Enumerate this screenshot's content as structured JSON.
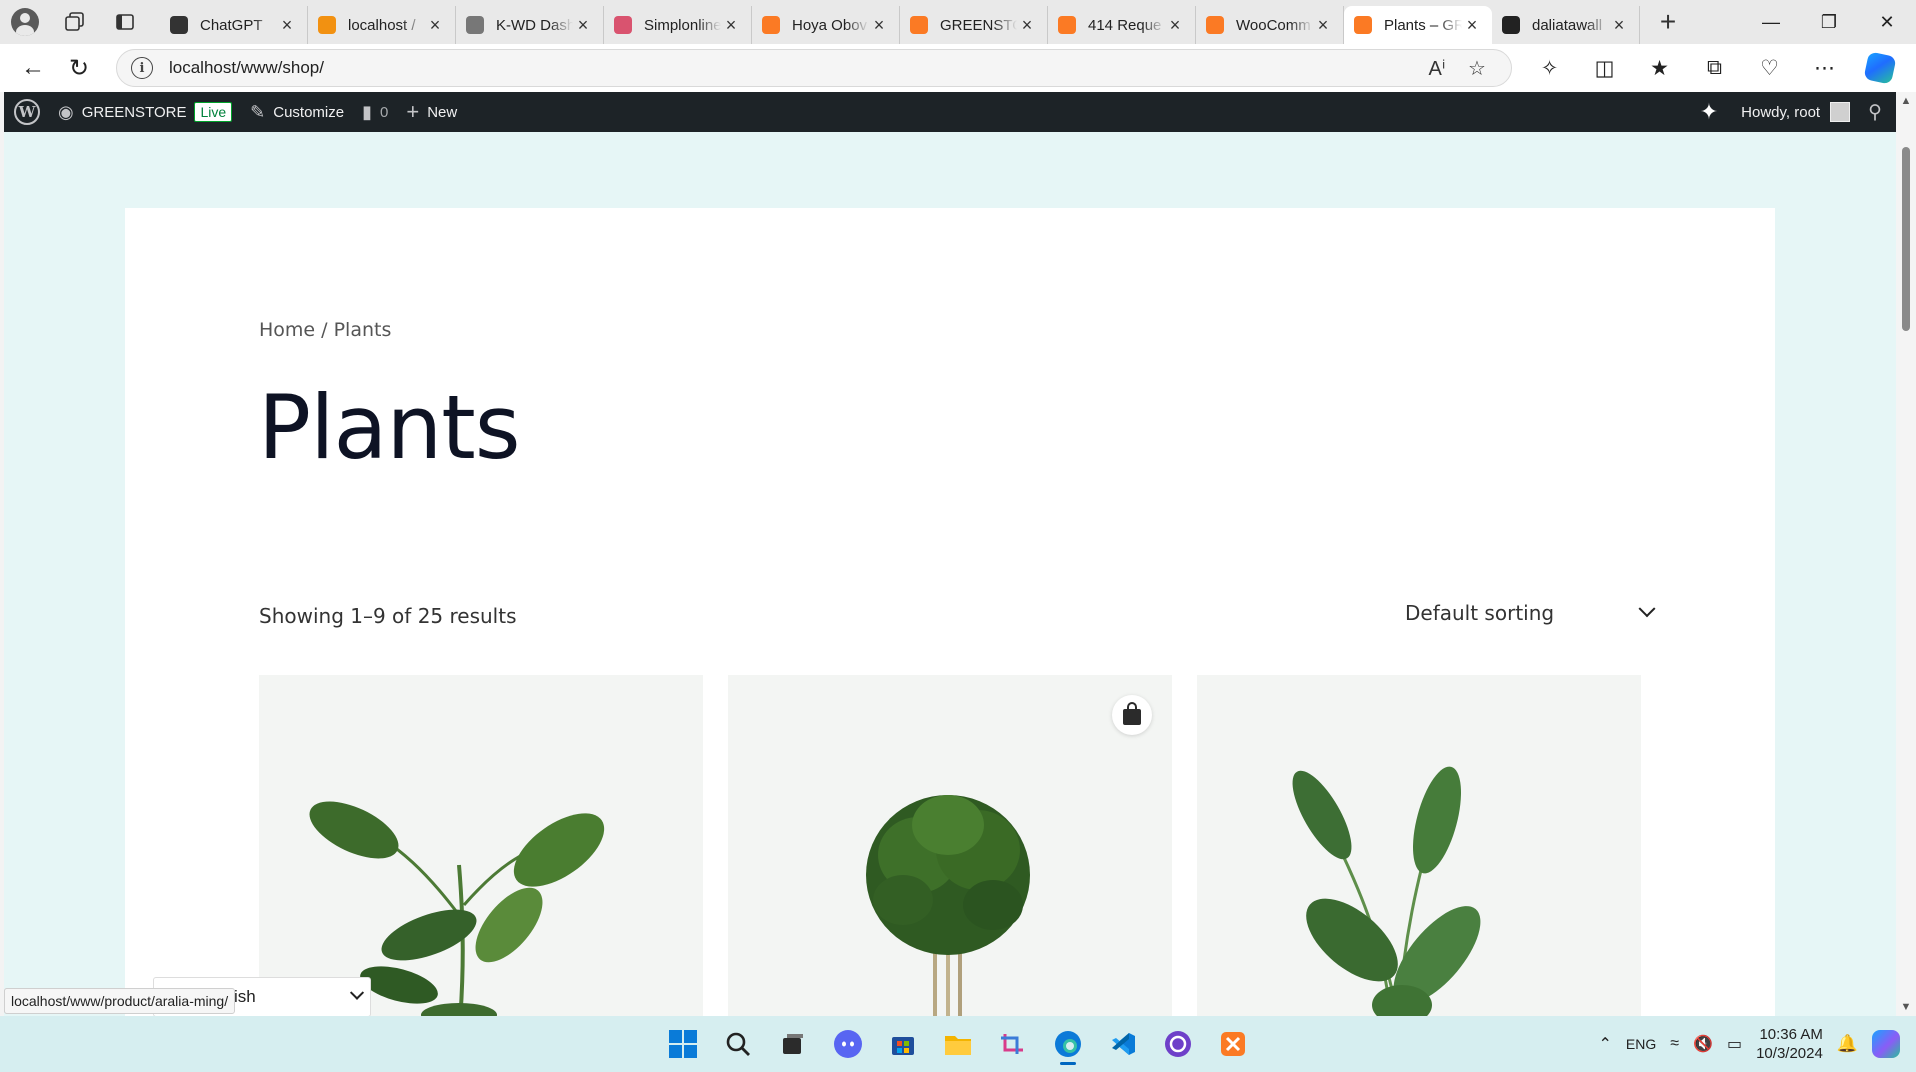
{
  "browser": {
    "tabs": [
      {
        "label": "ChatGPT",
        "icon": "chatgpt-icon",
        "color": "#333333",
        "active": false
      },
      {
        "label": "localhost / ",
        "icon": "phpmyadmin-icon",
        "color": "#f29111",
        "active": false
      },
      {
        "label": "K-WD Dash",
        "icon": "document-icon",
        "color": "#777777",
        "active": false
      },
      {
        "label": "Simplonline",
        "icon": "simplon-icon",
        "color": "#d9536f",
        "active": false
      },
      {
        "label": "Hoya Obov",
        "icon": "xampp-icon",
        "color": "#fb7a24",
        "active": false
      },
      {
        "label": "GREENSTO",
        "icon": "xampp-icon",
        "color": "#fb7a24",
        "active": false
      },
      {
        "label": "414 Reque",
        "icon": "xampp-icon",
        "color": "#fb7a24",
        "active": false
      },
      {
        "label": "WooComm",
        "icon": "xampp-icon",
        "color": "#fb7a24",
        "active": false
      },
      {
        "label": "Plants – GR",
        "icon": "xampp-icon",
        "color": "#fb7a24",
        "active": true
      },
      {
        "label": "daliatawall",
        "icon": "github-icon",
        "color": "#222222",
        "active": false
      }
    ],
    "url": "localhost/www/shop/"
  },
  "adminbar": {
    "site_name": "GREENSTORE",
    "live_badge": "Live",
    "customize": "Customize",
    "comments_count": "0",
    "new_label": "New",
    "howdy": "Howdy, root"
  },
  "page": {
    "breadcrumb": "Home / Plants",
    "title": "Plants",
    "result_count": "Showing 1–9 of 25 results",
    "sorting": "Default sorting"
  },
  "products": [
    {
      "name": "aralia-ming-image",
      "plant": "philodendron"
    },
    {
      "name": "bushy-plant-image",
      "plant": "aralia"
    },
    {
      "name": "strelitzia-image",
      "plant": "strelitzia"
    }
  ],
  "language_switcher": {
    "label": "English"
  },
  "status_bar": {
    "url": "localhost/www/product/aralia-ming/"
  },
  "taskbar": {
    "language": "ENG",
    "time": "10:36 AM",
    "date": "10/3/2024"
  },
  "colors": {
    "adminbar_bg": "#1d2327",
    "page_bg": "#e6f6f6",
    "title_color": "#0e1324",
    "taskbar_bg": "#d6eef0"
  }
}
